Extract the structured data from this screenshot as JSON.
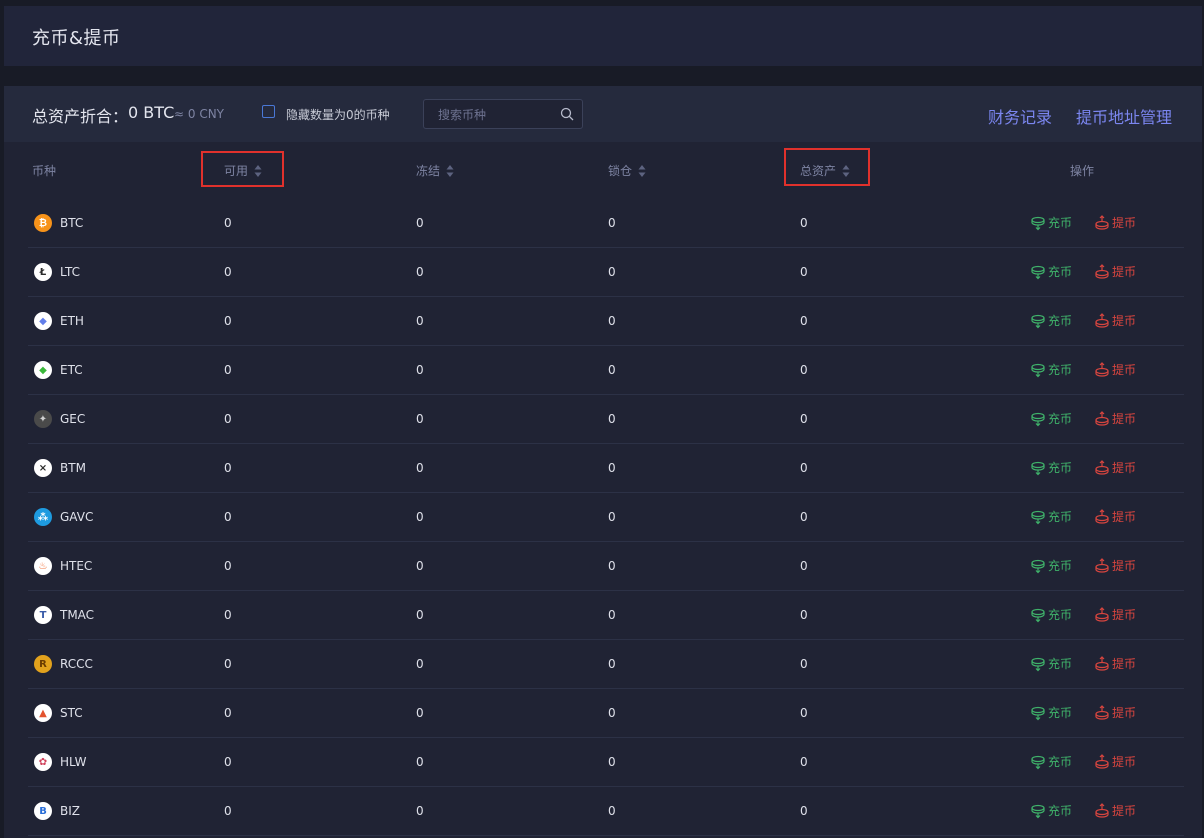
{
  "page": {
    "title": "充币&提币"
  },
  "toolbar": {
    "total_label": "总资产折合：",
    "total_btc": "0 BTC",
    "total_cny": "≈ 0 CNY",
    "hide_zero_label": "隐藏数量为0的币种",
    "search_placeholder": "搜索币种",
    "records_link": "财务记录",
    "address_link": "提币地址管理"
  },
  "table": {
    "headers": {
      "coin": "币种",
      "available": "可用",
      "frozen": "冻结",
      "locked": "锁仓",
      "total": "总资产",
      "actions": "操作"
    },
    "deposit_label": "充币",
    "withdraw_label": "提币",
    "rows": [
      {
        "coin": "BTC",
        "icon": "btc-icon",
        "color": "#f7931a",
        "available": "0",
        "frozen": "0",
        "locked": "0",
        "total": "0"
      },
      {
        "coin": "LTC",
        "icon": "ltc-icon",
        "color": "#ffffff",
        "available": "0",
        "frozen": "0",
        "locked": "0",
        "total": "0"
      },
      {
        "coin": "ETH",
        "icon": "eth-icon",
        "color": "#ffffff",
        "available": "0",
        "frozen": "0",
        "locked": "0",
        "total": "0"
      },
      {
        "coin": "ETC",
        "icon": "etc-icon",
        "color": "#ffffff",
        "available": "0",
        "frozen": "0",
        "locked": "0",
        "total": "0"
      },
      {
        "coin": "GEC",
        "icon": "gec-icon",
        "color": "#4a4a4a",
        "available": "0",
        "frozen": "0",
        "locked": "0",
        "total": "0"
      },
      {
        "coin": "BTM",
        "icon": "btm-icon",
        "color": "#ffffff",
        "available": "0",
        "frozen": "0",
        "locked": "0",
        "total": "0"
      },
      {
        "coin": "GAVC",
        "icon": "gavc-icon",
        "color": "#1e9be0",
        "available": "0",
        "frozen": "0",
        "locked": "0",
        "total": "0"
      },
      {
        "coin": "HTEC",
        "icon": "htec-icon",
        "color": "#ffffff",
        "available": "0",
        "frozen": "0",
        "locked": "0",
        "total": "0"
      },
      {
        "coin": "TMAC",
        "icon": "tmac-icon",
        "color": "#ffffff",
        "available": "0",
        "frozen": "0",
        "locked": "0",
        "total": "0"
      },
      {
        "coin": "RCCC",
        "icon": "rccc-icon",
        "color": "#e2a21d",
        "available": "0",
        "frozen": "0",
        "locked": "0",
        "total": "0"
      },
      {
        "coin": "STC",
        "icon": "stc-icon",
        "color": "#ffffff",
        "available": "0",
        "frozen": "0",
        "locked": "0",
        "total": "0"
      },
      {
        "coin": "HLW",
        "icon": "hlw-icon",
        "color": "#ffffff",
        "available": "0",
        "frozen": "0",
        "locked": "0",
        "total": "0"
      },
      {
        "coin": "BIZ",
        "icon": "biz-icon",
        "color": "#ffffff",
        "available": "0",
        "frozen": "0",
        "locked": "0",
        "total": "0"
      }
    ]
  },
  "colors": {
    "accent_link": "#7b86f0",
    "deposit": "#3fb26a",
    "withdraw": "#d8453f",
    "highlight_box": "#e0312c"
  }
}
